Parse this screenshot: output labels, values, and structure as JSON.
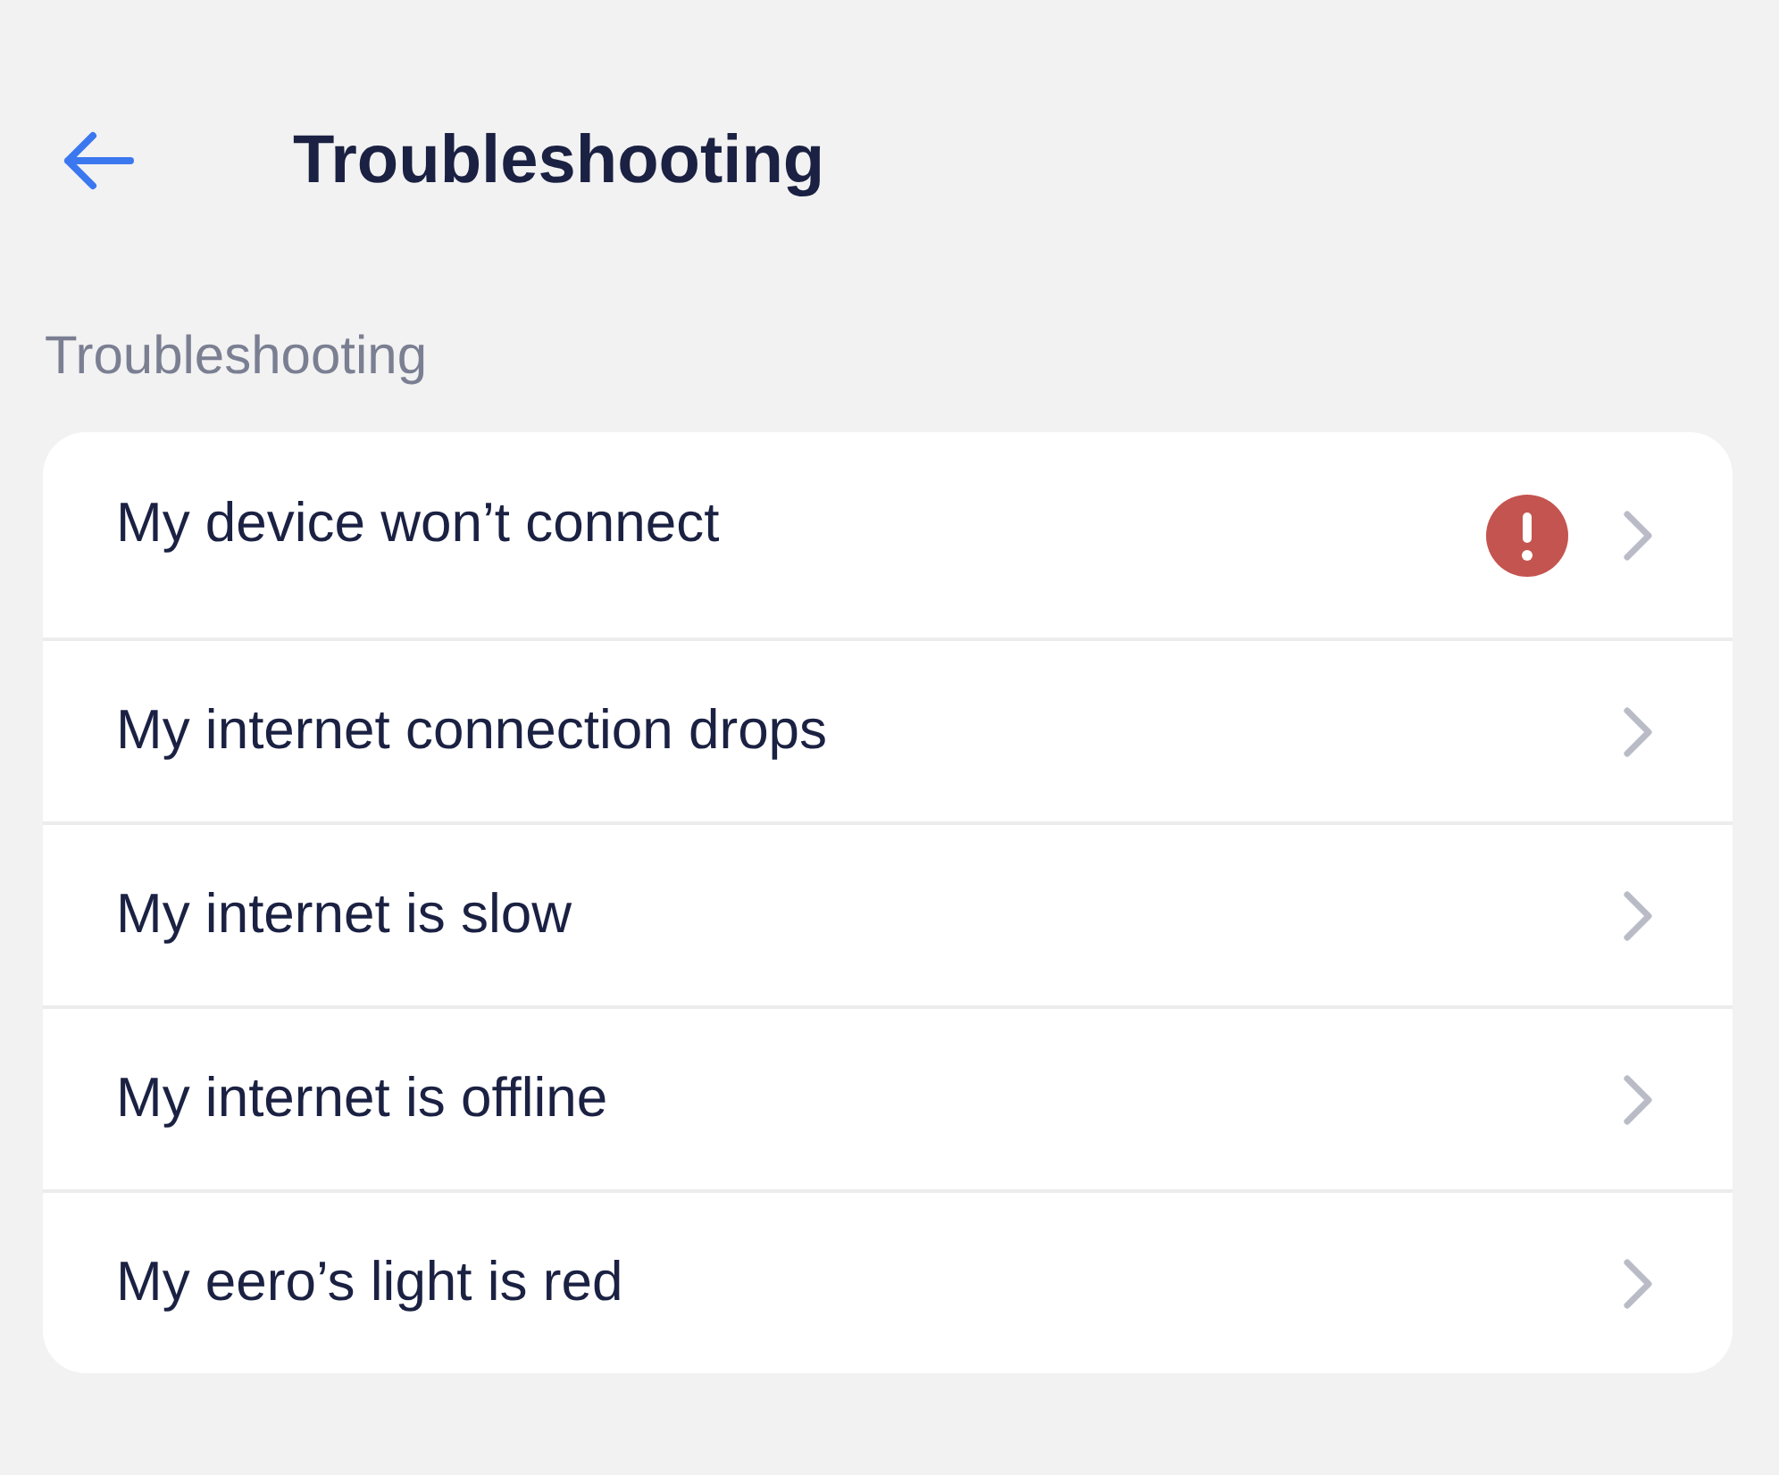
{
  "header": {
    "title": "Troubleshooting"
  },
  "section": {
    "label": "Troubleshooting"
  },
  "items": [
    {
      "label": "My device won’t connect",
      "alert": true
    },
    {
      "label": "My internet connection drops",
      "alert": false
    },
    {
      "label": "My internet is slow",
      "alert": false
    },
    {
      "label": "My internet is offline",
      "alert": false
    },
    {
      "label": "My eero’s light is red",
      "alert": false
    }
  ]
}
